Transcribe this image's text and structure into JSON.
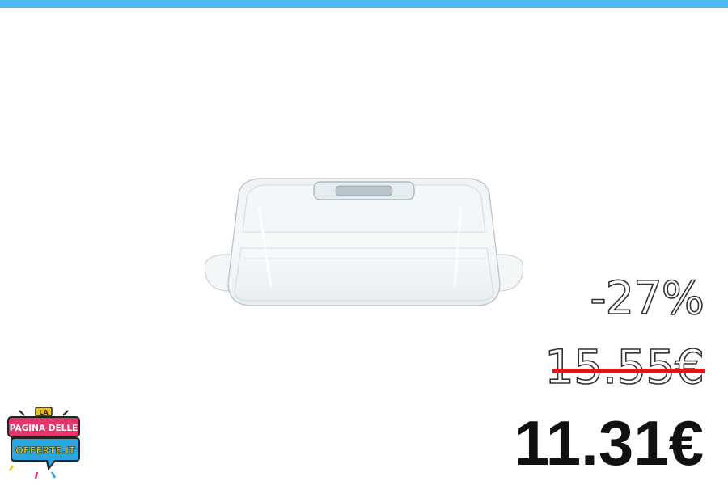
{
  "theme": {
    "accent": "#4db8f5",
    "strike_color": "#e0161d",
    "price_color": "#111111"
  },
  "product": {
    "image_name": "butter-dish-image"
  },
  "pricing": {
    "discount": "-27%",
    "old_price": "15.55€",
    "new_price": "11.31€"
  },
  "logo": {
    "line1": "LA",
    "line2": "PAGINA DELLE",
    "line3": "OFFERTE.IT"
  }
}
